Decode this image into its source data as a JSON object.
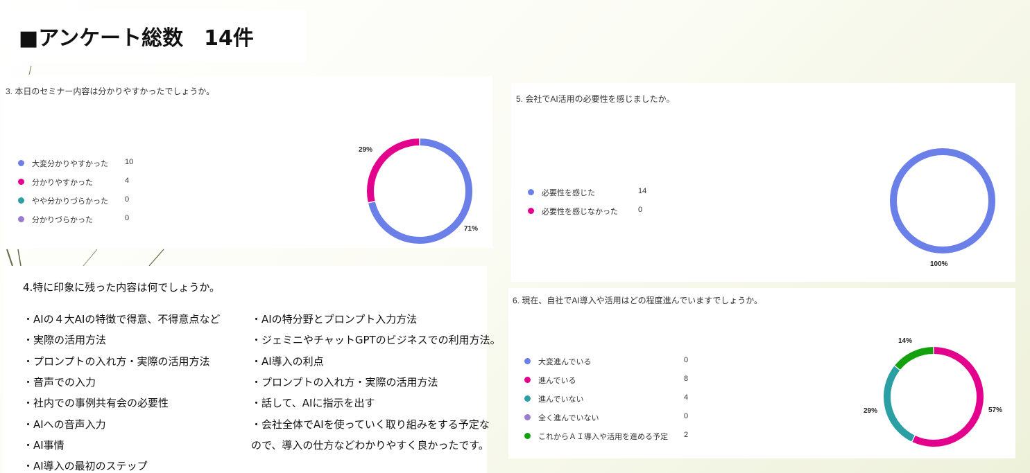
{
  "header": {
    "title": "■アンケート総数　14件"
  },
  "q3": {
    "title": "3. 本日のセミナー内容は分かりやすかったでしょうか。",
    "legend": [
      {
        "label": "大変分かりやすかった",
        "count": "10",
        "color": "#6b7fe8"
      },
      {
        "label": "分かりやすかった",
        "count": "4",
        "color": "#e3008c"
      },
      {
        "label": "やや分かりづらかった",
        "count": "0",
        "color": "#2aa0a4"
      },
      {
        "label": "分かりづらかった",
        "count": "0",
        "color": "#9b7bcf"
      }
    ],
    "pct_labels": [
      "29%",
      "71%"
    ]
  },
  "q5": {
    "title": "5. 会社でAI活用の必要性を感じましたか。",
    "legend": [
      {
        "label": "必要性を感じた",
        "count": "14",
        "color": "#6b7fe8"
      },
      {
        "label": "必要性を感じなかった",
        "count": "0",
        "color": "#e3008c"
      }
    ],
    "pct_labels": [
      "100%"
    ]
  },
  "q6": {
    "title": "6. 現在、自社でAI導入や活用はどの程度進んでいますでしょうか。",
    "legend": [
      {
        "label": "大変進んでいる",
        "count": "0",
        "color": "#6b7fe8"
      },
      {
        "label": "進んでいる",
        "count": "8",
        "color": "#e3008c"
      },
      {
        "label": "進んでいない",
        "count": "4",
        "color": "#2aa0a4"
      },
      {
        "label": "全く進んでいない",
        "count": "0",
        "color": "#9b7bcf"
      },
      {
        "label": "これからＡＩ導入や活用を進める予定",
        "count": "2",
        "color": "#13a10e"
      }
    ],
    "pct_labels": [
      "14%",
      "29%",
      "57%"
    ]
  },
  "q4": {
    "title": "4.特に印象に残った内容は何でしょうか。",
    "col1": [
      "・AIの４大AIの特徴で得意、不得意点など",
      "・実際の活用方法",
      "・プロンプトの入れ方・実際の活用方法",
      "・音声での入力",
      "・社内での事例共有会の必要性",
      "・AIへの音声入力",
      "・AI事情",
      "・AI導入の最初のステップ"
    ],
    "col2": [
      "・AIの特分野とプロンプト入力方法",
      "・ジェミニやチャットGPTのビジネスでの利用方法。",
      "・AI導入の利点",
      "・プロンプトの入れ方・実際の活用方法",
      "・話して、AIに指示を出す",
      "・会社全体でAIを使っていく取り組みをする予定な",
      "ので、導入の仕方などわかりやすく良かったです。"
    ]
  },
  "chart_data": [
    {
      "type": "pie",
      "title": "3. 本日のセミナー内容は分かりやすかったでしょうか。",
      "categories": [
        "大変分かりやすかった",
        "分かりやすかった",
        "やや分かりづらかった",
        "分かりづらかった"
      ],
      "values": [
        10,
        4,
        0,
        0
      ],
      "colors": [
        "#6b7fe8",
        "#e3008c",
        "#2aa0a4",
        "#9b7bcf"
      ],
      "legend": "left"
    },
    {
      "type": "pie",
      "title": "5. 会社でAI活用の必要性を感じましたか。",
      "categories": [
        "必要性を感じた",
        "必要性を感じなかった"
      ],
      "values": [
        14,
        0
      ],
      "colors": [
        "#6b7fe8",
        "#e3008c"
      ],
      "legend": "left"
    },
    {
      "type": "pie",
      "title": "6. 現在、自社でAI導入や活用はどの程度進んでいますでしょうか。",
      "categories": [
        "大変進んでいる",
        "進んでいる",
        "進んでいない",
        "全く進んでいない",
        "これからＡＩ導入や活用を進める予定"
      ],
      "values": [
        0,
        8,
        4,
        0,
        2
      ],
      "colors": [
        "#6b7fe8",
        "#e3008c",
        "#2aa0a4",
        "#9b7bcf",
        "#13a10e"
      ],
      "legend": "left"
    }
  ]
}
